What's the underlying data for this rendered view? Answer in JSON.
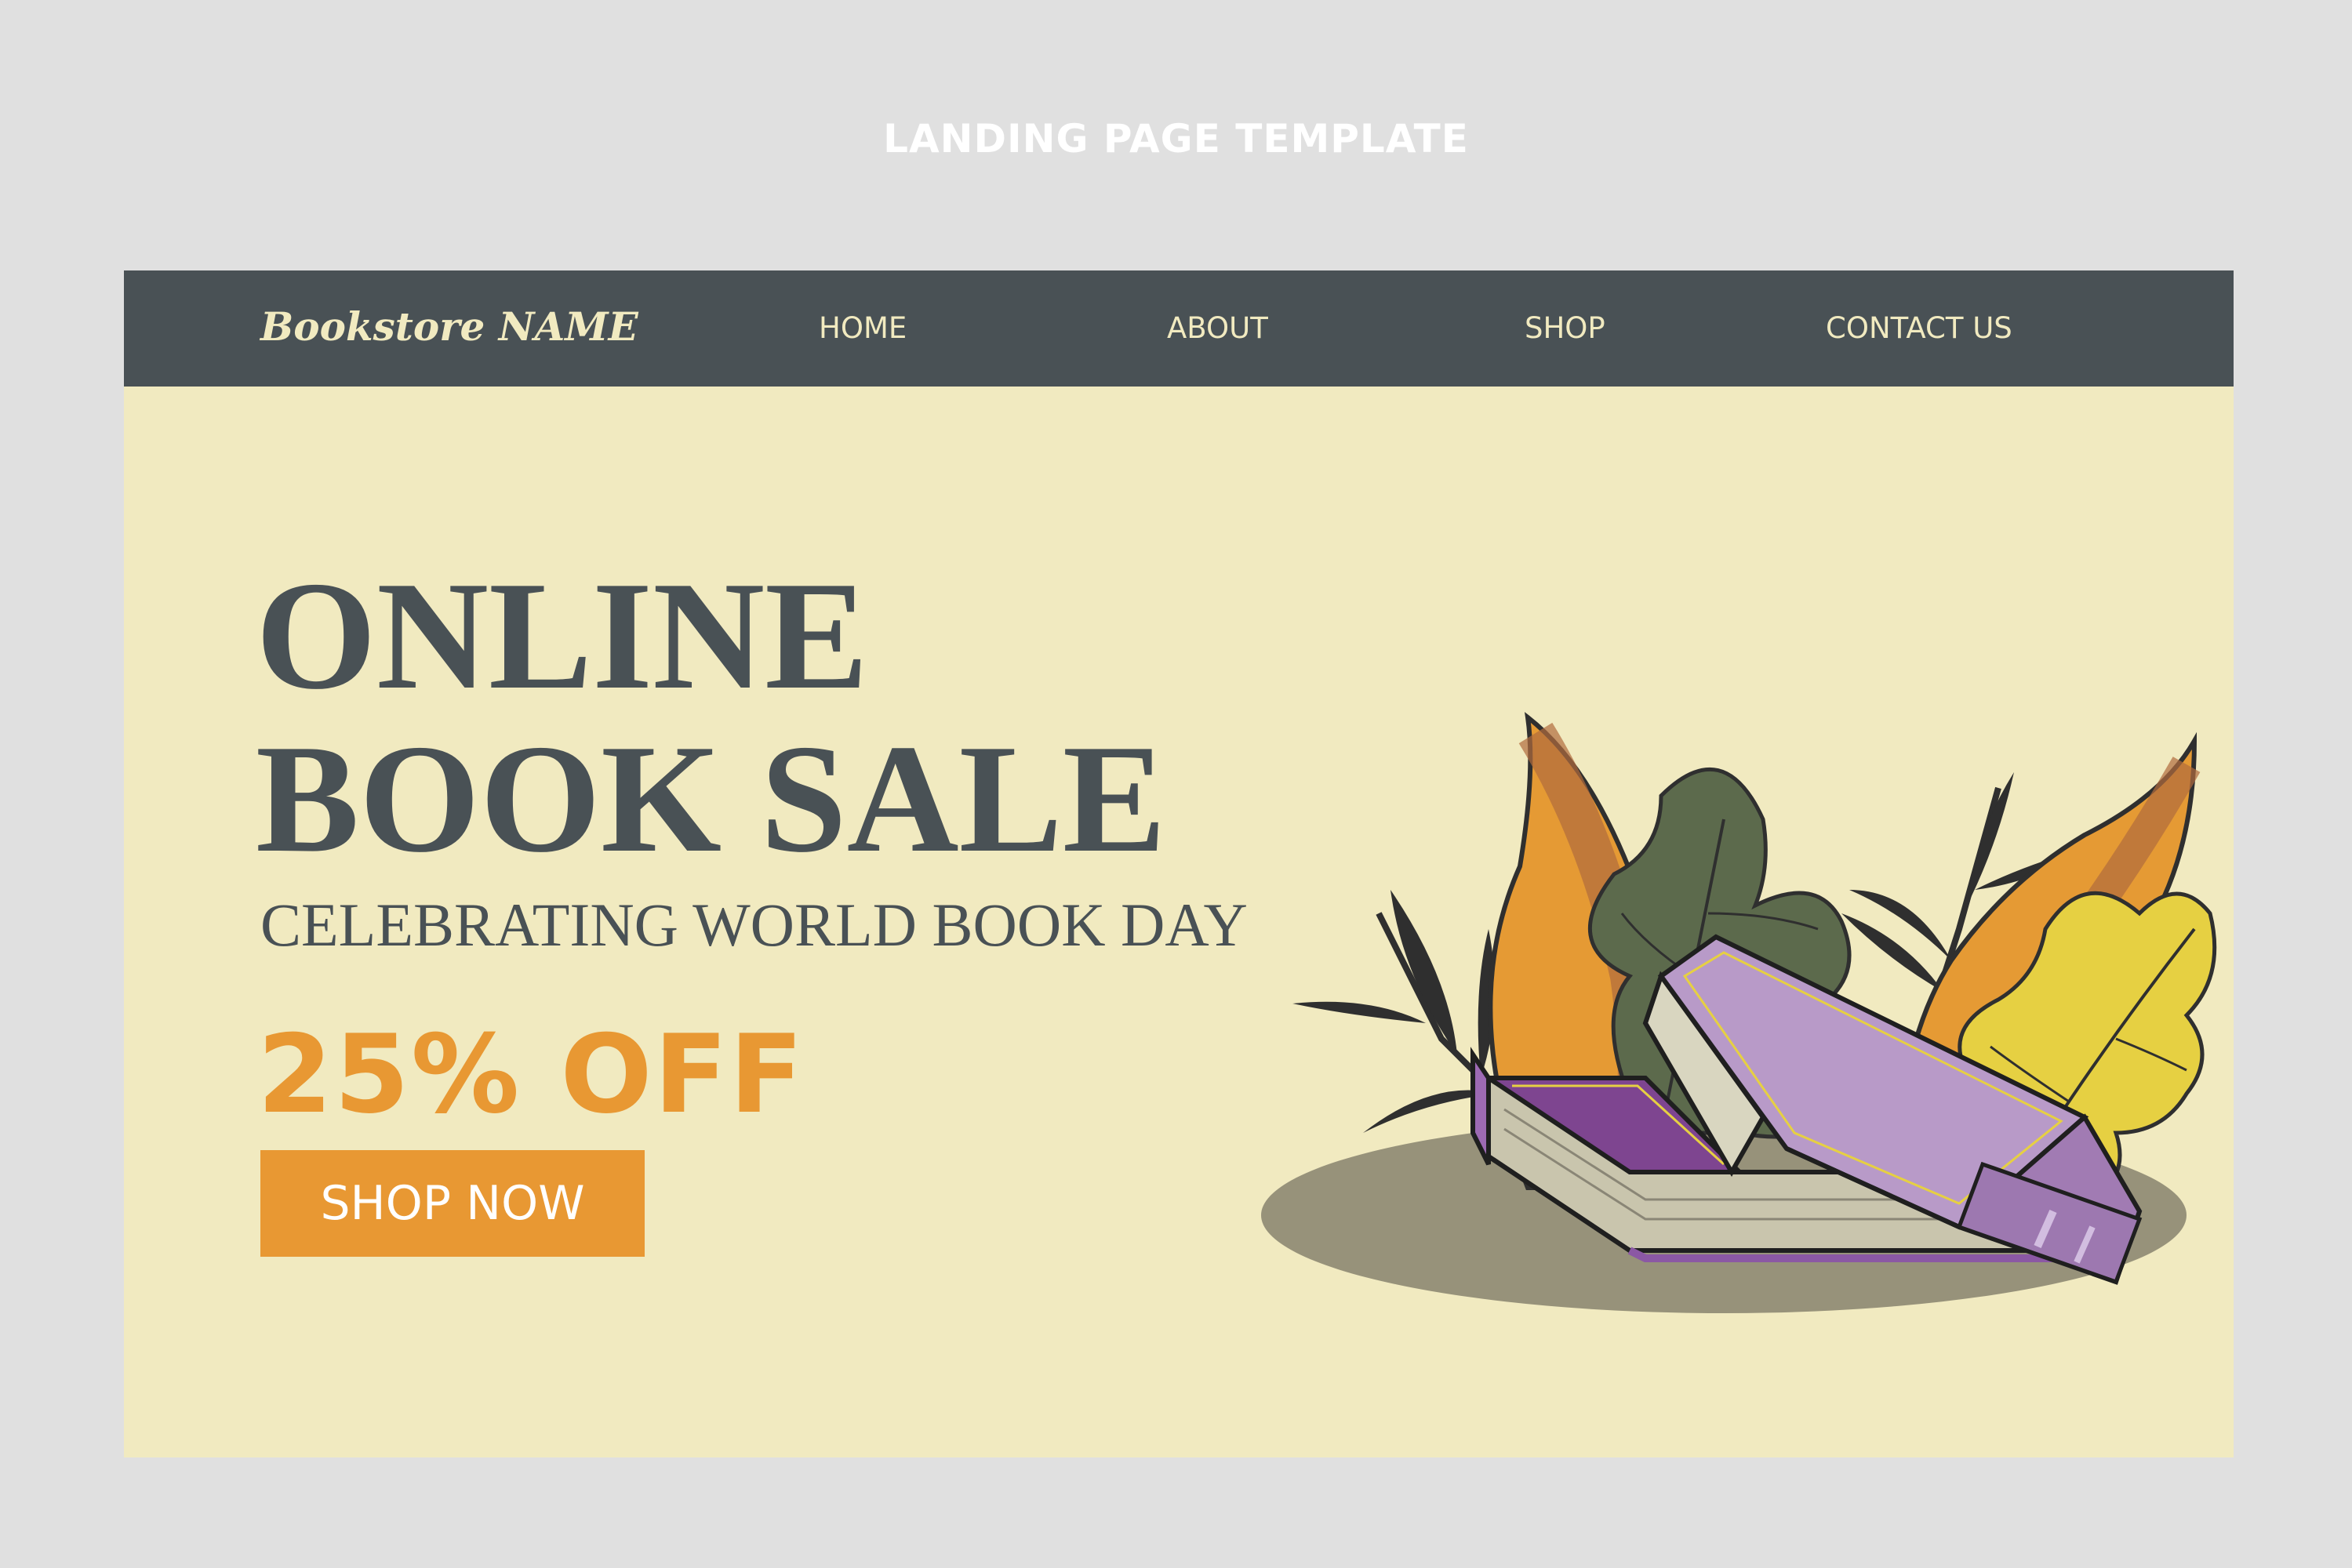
{
  "frame": {
    "title": "LANDING PAGE TEMPLATE"
  },
  "nav": {
    "brand": "Bookstore NAME",
    "links": [
      {
        "label": "HOME"
      },
      {
        "label": "ABOUT"
      },
      {
        "label": "SHOP"
      },
      {
        "label": "CONTACT US"
      }
    ]
  },
  "hero": {
    "headline_line1": "ONLINE",
    "headline_line2": "BOOK SALE",
    "subheadline": "CELEBRATING WORLD BOOK DAY",
    "discount": "25% OFF",
    "cta_label": "SHOP NOW"
  },
  "colors": {
    "background": "#e0e0e0",
    "page": "#f1eac0",
    "navbar": "#495155",
    "text_dark": "#495155",
    "accent": "#e89833",
    "book_purple": "#b89ac8",
    "leaf_green": "#5a6b4a"
  }
}
